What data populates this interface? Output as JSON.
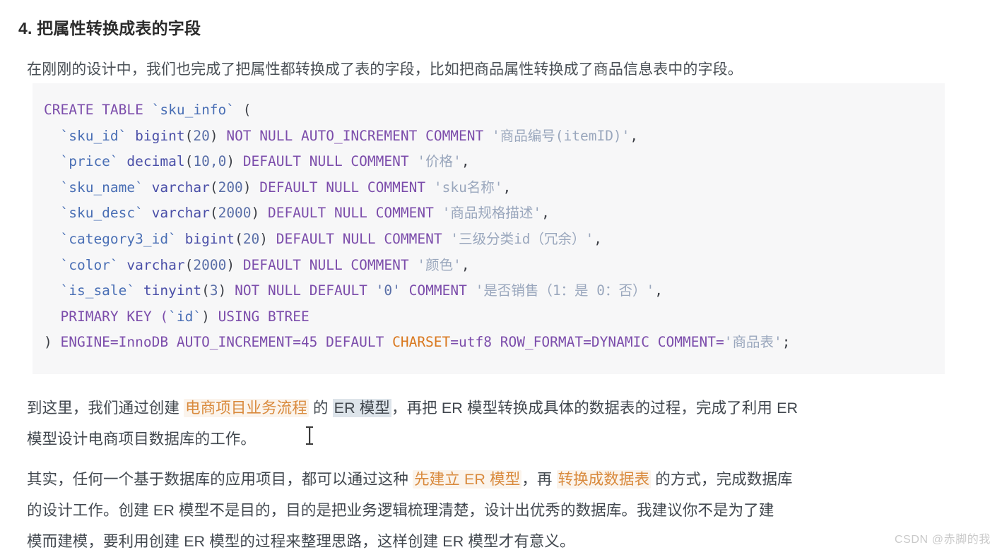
{
  "heading": "4. 把属性转换成表的字段",
  "intro": "在刚刚的设计中，我们也完成了把属性都转换成了表的字段，比如把商品属性转换成了商品信息表中的字段。",
  "code": {
    "language": "sql",
    "lines": [
      {
        "tokens": [
          {
            "t": "CREATE TABLE ",
            "c": "kw"
          },
          {
            "t": "`sku_info`",
            "c": "ident"
          },
          {
            "t": " (",
            "c": "punc"
          }
        ]
      },
      {
        "tokens": [
          {
            "t": "  ",
            "c": "plain"
          },
          {
            "t": "`sku_id`",
            "c": "ident"
          },
          {
            "t": " ",
            "c": "plain"
          },
          {
            "t": "bigint",
            "c": "type"
          },
          {
            "t": "(",
            "c": "punc"
          },
          {
            "t": "20",
            "c": "num"
          },
          {
            "t": ") ",
            "c": "punc"
          },
          {
            "t": "NOT NULL AUTO_INCREMENT COMMENT ",
            "c": "kw"
          },
          {
            "t": "'商品编号(itemID)'",
            "c": "str"
          },
          {
            "t": ",",
            "c": "punc"
          }
        ]
      },
      {
        "tokens": [
          {
            "t": "  ",
            "c": "plain"
          },
          {
            "t": "`price`",
            "c": "ident"
          },
          {
            "t": " ",
            "c": "plain"
          },
          {
            "t": "decimal",
            "c": "type"
          },
          {
            "t": "(",
            "c": "punc"
          },
          {
            "t": "10,0",
            "c": "num"
          },
          {
            "t": ") ",
            "c": "punc"
          },
          {
            "t": "DEFAULT NULL COMMENT ",
            "c": "kw"
          },
          {
            "t": "'价格'",
            "c": "str"
          },
          {
            "t": ",",
            "c": "punc"
          }
        ]
      },
      {
        "tokens": [
          {
            "t": "  ",
            "c": "plain"
          },
          {
            "t": "`sku_name`",
            "c": "ident"
          },
          {
            "t": " ",
            "c": "plain"
          },
          {
            "t": "varchar",
            "c": "type"
          },
          {
            "t": "(",
            "c": "punc"
          },
          {
            "t": "200",
            "c": "num"
          },
          {
            "t": ") ",
            "c": "punc"
          },
          {
            "t": "DEFAULT NULL COMMENT ",
            "c": "kw"
          },
          {
            "t": "'sku名称'",
            "c": "str"
          },
          {
            "t": ",",
            "c": "punc"
          }
        ]
      },
      {
        "tokens": [
          {
            "t": "  ",
            "c": "plain"
          },
          {
            "t": "`sku_desc`",
            "c": "ident"
          },
          {
            "t": " ",
            "c": "plain"
          },
          {
            "t": "varchar",
            "c": "type"
          },
          {
            "t": "(",
            "c": "punc"
          },
          {
            "t": "2000",
            "c": "num"
          },
          {
            "t": ") ",
            "c": "punc"
          },
          {
            "t": "DEFAULT NULL COMMENT ",
            "c": "kw"
          },
          {
            "t": "'商品规格描述'",
            "c": "str"
          },
          {
            "t": ",",
            "c": "punc"
          }
        ]
      },
      {
        "tokens": [
          {
            "t": "  ",
            "c": "plain"
          },
          {
            "t": "`category3_id`",
            "c": "ident"
          },
          {
            "t": " ",
            "c": "plain"
          },
          {
            "t": "bigint",
            "c": "type"
          },
          {
            "t": "(",
            "c": "punc"
          },
          {
            "t": "20",
            "c": "num"
          },
          {
            "t": ") ",
            "c": "punc"
          },
          {
            "t": "DEFAULT NULL COMMENT ",
            "c": "kw"
          },
          {
            "t": "'三级分类id（冗余）'",
            "c": "str"
          },
          {
            "t": ",",
            "c": "punc"
          }
        ]
      },
      {
        "tokens": [
          {
            "t": "  ",
            "c": "plain"
          },
          {
            "t": "`color`",
            "c": "ident"
          },
          {
            "t": " ",
            "c": "plain"
          },
          {
            "t": "varchar",
            "c": "type"
          },
          {
            "t": "(",
            "c": "punc"
          },
          {
            "t": "2000",
            "c": "num"
          },
          {
            "t": ") ",
            "c": "punc"
          },
          {
            "t": "DEFAULT NULL COMMENT ",
            "c": "kw"
          },
          {
            "t": "'颜色'",
            "c": "str"
          },
          {
            "t": ",",
            "c": "punc"
          }
        ]
      },
      {
        "tokens": [
          {
            "t": "  ",
            "c": "plain"
          },
          {
            "t": "`is_sale`",
            "c": "ident"
          },
          {
            "t": " ",
            "c": "plain"
          },
          {
            "t": "tinyint",
            "c": "type"
          },
          {
            "t": "(",
            "c": "punc"
          },
          {
            "t": "3",
            "c": "num"
          },
          {
            "t": ") ",
            "c": "punc"
          },
          {
            "t": "NOT NULL DEFAULT ",
            "c": "kw"
          },
          {
            "t": "'0'",
            "c": "num"
          },
          {
            "t": " COMMENT ",
            "c": "kw"
          },
          {
            "t": "'是否销售（1：是 0：否）'",
            "c": "str"
          },
          {
            "t": ",",
            "c": "punc"
          }
        ]
      },
      {
        "tokens": [
          {
            "t": "  ",
            "c": "plain"
          },
          {
            "t": "PRIMARY KEY (",
            "c": "kw"
          },
          {
            "t": "`id`",
            "c": "ident"
          },
          {
            "t": ") ",
            "c": "punc"
          },
          {
            "t": "USING BTREE",
            "c": "kw"
          }
        ]
      },
      {
        "tokens": [
          {
            "t": ") ",
            "c": "punc"
          },
          {
            "t": "ENGINE=InnoDB AUTO_INCREMENT=45 DEFAULT ",
            "c": "kw"
          },
          {
            "t": "CHARSET",
            "c": "orange"
          },
          {
            "t": "=utf8 ROW_FORMAT=DYNAMIC COMMENT=",
            "c": "kw"
          },
          {
            "t": "'商品表'",
            "c": "str"
          },
          {
            "t": ";",
            "c": "punc"
          }
        ]
      }
    ]
  },
  "paragraph_1": {
    "line_1": [
      {
        "t": "到这里，我们通过创建 ",
        "c": ""
      },
      {
        "t": "电商项目业务流程",
        "c": "hl-orange"
      },
      {
        "t": " 的 ",
        "c": ""
      },
      {
        "t": "ER 模型",
        "c": "hl-select"
      },
      {
        "t": "，再把 ER 模型转换成具体的数据表的过程，完成了利用 ER",
        "c": ""
      }
    ],
    "line_2": [
      {
        "t": "模型设计电商项目数据库的工作。",
        "c": ""
      }
    ]
  },
  "paragraph_2": {
    "line_1": [
      {
        "t": "其实，任何一个基于数据库的应用项目，都可以通过这种 ",
        "c": ""
      },
      {
        "t": "先建立 ER 模型",
        "c": "hl-orange"
      },
      {
        "t": "，再 ",
        "c": ""
      },
      {
        "t": "转换成数据表",
        "c": "hl-orange"
      },
      {
        "t": " 的方式，完成数据库",
        "c": ""
      }
    ],
    "line_2": [
      {
        "t": "的设计工作。创建 ER 模型不是目的，目的是把业务逻辑梳理清楚，设计出优秀的数据库。我建议你不是为了建",
        "c": ""
      }
    ],
    "line_3": [
      {
        "t": "模而建模，要利用创建 ER 模型的过程来整理思路，这样创建 ER 模型才有意义。",
        "c": ""
      }
    ]
  },
  "watermark": "CSDN @赤脚的我",
  "colors": {
    "code_background": "#f7f7f8",
    "keyword": "#7c4dab",
    "identifier": "#4a6fb5",
    "string": "#9aa7bd",
    "charset_orange": "#d9781f",
    "highlight_orange_text": "#d98a3d",
    "highlight_orange_bg": "#fbf4ec",
    "selection_bg": "#dde4ea",
    "body_text": "#42484f",
    "heading_text": "#2b2b2b",
    "watermark": "#c9c9c9"
  }
}
